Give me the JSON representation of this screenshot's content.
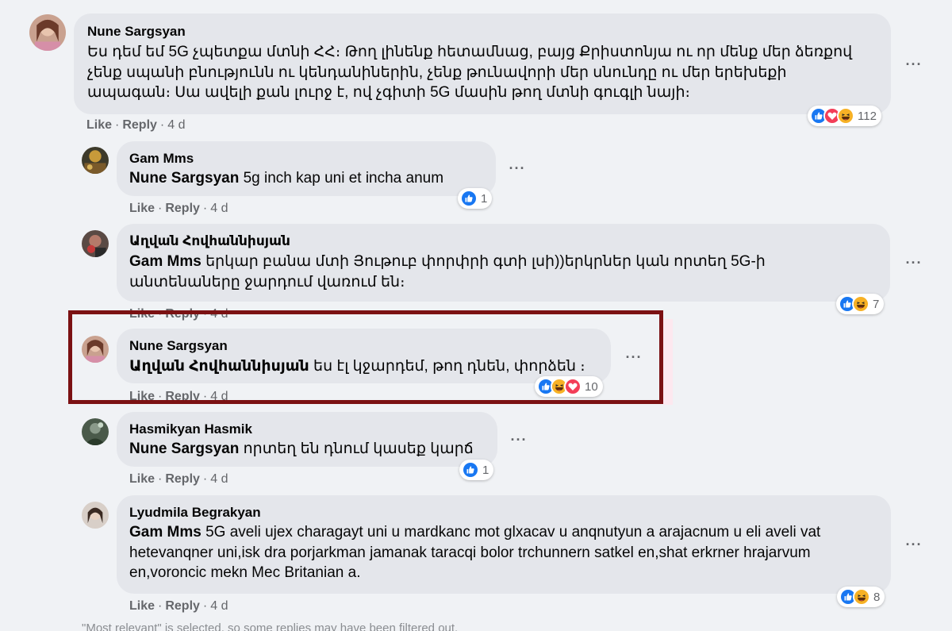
{
  "comments": [
    {
      "author": "Nune Sargsyan",
      "mention": "",
      "text": "Ես դեմ եմ 5G չպետքա մտնի ՀՀ։ Թող լինենք հետամնաց, բայց Քրիստոնյա ու որ մենք մեր ձեռքով չենք սպանի բնությունն ու կենդանիներին, չենք թունավորի մեր սնունդը ու մեր երեխեքի ապագան։ Սա ավելի քան լուրջ է, ով չգիտի 5G մասին թող մտնի գուգլի նայի։",
      "like": "Like",
      "reply": "Reply",
      "time": "4 d",
      "reactions": [
        "like",
        "love",
        "haha"
      ],
      "reaction_count": "112"
    },
    {
      "author": "Gam Mms",
      "mention": "Nune Sargsyan",
      "text": "5g inch kap uni et incha anum",
      "like": "Like",
      "reply": "Reply",
      "time": "4 d",
      "reactions": [
        "like"
      ],
      "reaction_count": "1"
    },
    {
      "author": "Աղվան Հովհաննիսյան",
      "mention": "Gam Mms",
      "text": "երկար բանա մտի Յութուբ փորփրի գտի լսի))երկրներ կան որտեղ 5G-ի անտենաները ջարդում վառում են։",
      "like": "Like",
      "reply": "Reply",
      "time": "4 d",
      "reactions": [
        "like",
        "haha"
      ],
      "reaction_count": "7"
    },
    {
      "author": "Nune Sargsyan",
      "mention": "Աղվան Հովհաննիսյան",
      "text": "ես էլ կջարդեմ, թող դնեն, փորձեն ։",
      "like": "Like",
      "reply": "Reply",
      "time": "4 d",
      "reactions": [
        "like",
        "haha",
        "love"
      ],
      "reaction_count": "10"
    },
    {
      "author": "Hasmikyan Hasmik",
      "mention": "Nune Sargsyan",
      "text": "որտեղ են դնում կասեք կարճ",
      "like": "Like",
      "reply": "Reply",
      "time": "4 d",
      "reactions": [
        "like"
      ],
      "reaction_count": "1"
    },
    {
      "author": "Lyudmila Begrakyan",
      "mention": "Gam Mms",
      "text": "5G aveli ujex charagayt uni u mardkanc mot glxacav u anqnutyun a arajacnum u eli aveli vat hetevanqner uni,isk dra porjarkman jamanak taracqi bolor trchunnern satkel en,shat erkrner hrajarvum en,voroncic mekn Mec Britanian a.",
      "like": "Like",
      "reply": "Reply",
      "time": "4 d",
      "reactions": [
        "like",
        "haha"
      ],
      "reaction_count": "8"
    }
  ],
  "more_options_glyph": "···",
  "filtered_note": "\"Most relevant\" is selected, so some replies may have been filtered out.",
  "colors": {
    "page_bg": "#f0f2f5",
    "bubble_bg": "#e4e6eb",
    "secondary_text": "#65676b",
    "like_blue": "#1877f2",
    "love_red": "#f33e58",
    "haha_yellow": "#f7b125",
    "highlight_border": "#7b1113"
  }
}
